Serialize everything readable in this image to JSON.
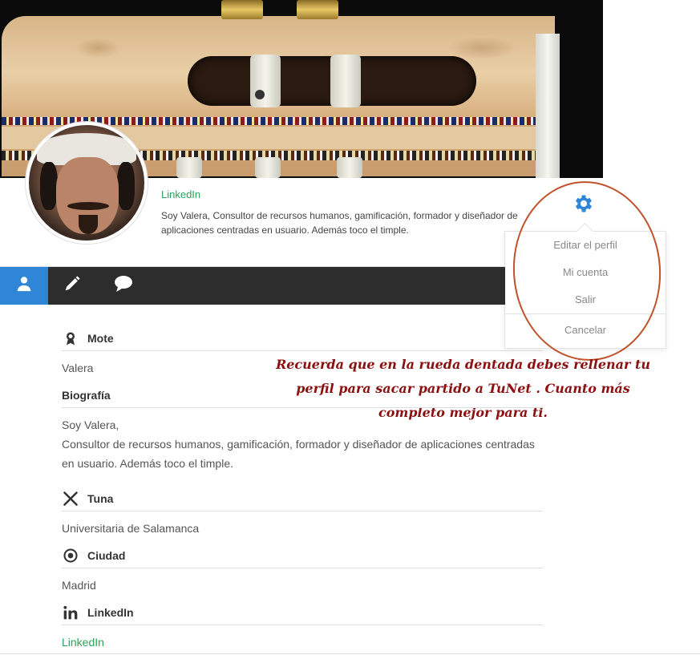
{
  "profile": {
    "link_text": "LinkedIn",
    "bio": "Soy Valera, Consultor de recursos humanos, gamificación, formador y diseñador de aplicaciones centradas en usuario. Además toco el timple."
  },
  "settings_menu": {
    "items": [
      "Editar el perfil",
      "Mi cuenta",
      "Salir"
    ],
    "cancel": "Cancelar"
  },
  "tabs": [
    {
      "name": "user-icon"
    },
    {
      "name": "pencil-icon"
    },
    {
      "name": "chat-icon"
    }
  ],
  "annotation": {
    "text": "Recuerda que en la rueda dentada debes rellenar tu perfil para sacar partido a TuNet . Cuanto más completo mejor para ti."
  },
  "details": {
    "mote": {
      "label": "Mote",
      "value": "Valera"
    },
    "biografia": {
      "label": "Biografía",
      "line1": "Soy Valera,",
      "line2": "Consultor de recursos humanos, gamificación, formador y diseñador de aplicaciones centradas en usuario. Además toco el timple."
    },
    "tuna": {
      "label": "Tuna",
      "value": "Universitaria de Salamanca"
    },
    "ciudad": {
      "label": "Ciudad",
      "value": "Madrid"
    },
    "linkedin": {
      "label": "LinkedIn",
      "value": "LinkedIn"
    }
  },
  "colors": {
    "accent": "#2f86d6",
    "link": "#2ba35a",
    "tabbar": "#2d2d2d",
    "annotation": "#8b1111"
  }
}
